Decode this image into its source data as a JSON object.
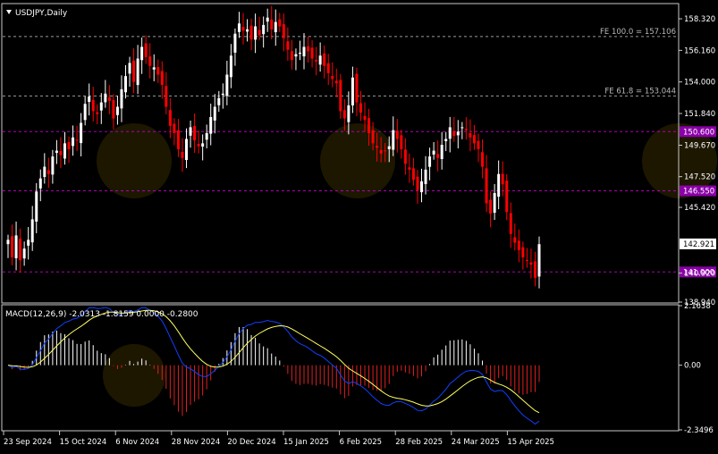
{
  "symbol_title": "USDJPY,Daily",
  "colors": {
    "background": "#000000",
    "frame": "#c8c8c8",
    "bull": "#ffffff",
    "bear": "#ff0000",
    "level_line_magenta": "#b000b0",
    "level_line_gray": "#9a9a9a",
    "level_label_bg": "#8b00a8",
    "current_price_bg": "#ffffff",
    "macd_line": "#1040ff",
    "signal_line": "#ffff60",
    "hist_positive": "#ffffff",
    "hist_negative": "#e02020",
    "text": "#ffffff"
  },
  "price_axis": [
    "158.320",
    "156.160",
    "154.000",
    "151.840",
    "149.670",
    "147.520",
    "145.420",
    "140.920",
    "138.940"
  ],
  "levels": [
    {
      "label": "150.600",
      "value": 150.6,
      "style": "magenta",
      "badge": true
    },
    {
      "label": "146.550",
      "value": 146.55,
      "style": "magenta",
      "badge": true
    },
    {
      "label": "141.000",
      "value": 141.0,
      "style": "magenta",
      "badge": true
    },
    {
      "label": "FE 100.0 = 157.106",
      "value": 157.106,
      "style": "gray",
      "badge": false
    },
    {
      "label": "FE 61.8 = 153.044",
      "value": 153.044,
      "style": "gray",
      "badge": false
    }
  ],
  "current_price": "142.921",
  "macd_label": "MACD(12,26,9) -2.0313 -1.8159 0.0000 -0.2800",
  "macd_axis": [
    "2.1638",
    "0.00",
    "-2.3496"
  ],
  "date_labels": [
    "23 Sep 2024",
    "15 Oct 2024",
    "6 Nov 2024",
    "28 Nov 2024",
    "20 Dec 2024",
    "15 Jan 2025",
    "6 Feb 2025",
    "28 Feb 2025",
    "24 Mar 2025",
    "15 Apr 2025"
  ],
  "chart_data": {
    "type": "candlestick",
    "title": "USDJPY,Daily",
    "price_range": [
      138.94,
      159.3
    ],
    "macd_range": [
      -2.3496,
      2.1638
    ],
    "closes": [
      143.2,
      142.0,
      143.5,
      141.8,
      142.6,
      143.2,
      144.6,
      146.5,
      147.4,
      148.2,
      147.7,
      148.9,
      149.3,
      149.0,
      149.8,
      149.4,
      150.2,
      150.0,
      151.2,
      152.5,
      153.0,
      152.0,
      151.8,
      152.6,
      153.2,
      152.7,
      151.5,
      152.3,
      153.5,
      154.4,
      155.3,
      154.0,
      155.6,
      156.4,
      155.7,
      155.1,
      155.0,
      154.5,
      153.8,
      152.3,
      151.0,
      150.5,
      149.4,
      148.8,
      150.1,
      150.9,
      150.0,
      149.6,
      149.8,
      150.5,
      151.6,
      152.3,
      152.9,
      153.2,
      154.5,
      155.8,
      157.3,
      158.0,
      157.5,
      157.6,
      156.9,
      157.8,
      157.2,
      157.9,
      158.4,
      157.6,
      158.1,
      157.8,
      157.0,
      156.2,
      155.5,
      155.9,
      156.0,
      156.4,
      156.1,
      155.6,
      155.4,
      155.8,
      155.1,
      154.6,
      154.2,
      153.9,
      152.0,
      151.5,
      152.4,
      154.3,
      152.6,
      151.9,
      151.4,
      150.5,
      149.8,
      149.5,
      149.1,
      149.3,
      149.6,
      150.7,
      150.1,
      149.4,
      148.4,
      148.0,
      147.3,
      146.6,
      147.2,
      148.0,
      148.9,
      149.3,
      148.8,
      149.7,
      150.1,
      150.9,
      150.3,
      150.6,
      150.9,
      150.7,
      150.2,
      149.8,
      149.4,
      148.2,
      145.7,
      145.0,
      146.4,
      147.7,
      147.0,
      145.1,
      143.6,
      143.0,
      142.5,
      142.0,
      141.8,
      141.5,
      140.6,
      142.9
    ],
    "macd_histogram_trend": "negative",
    "last_macd": -2.0313,
    "last_signal": -1.8159
  }
}
